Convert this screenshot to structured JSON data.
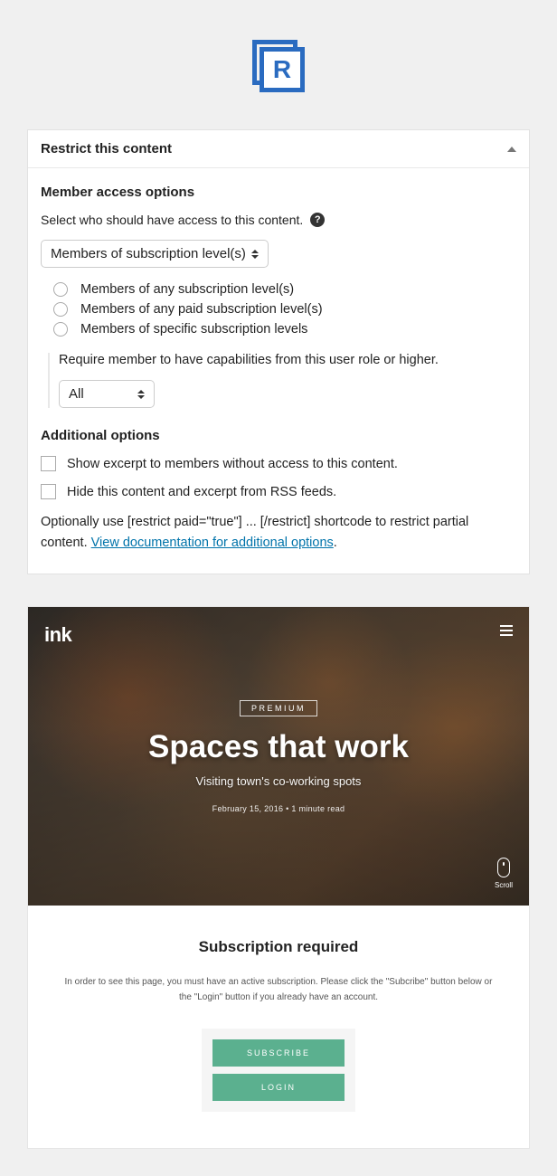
{
  "panel": {
    "title": "Restrict this content",
    "section1_title": "Member access options",
    "select_desc": "Select who should have access to this content.",
    "help_char": "?",
    "dropdown_value": "Members of subscription level(s)",
    "radios": [
      "Members of any subscription level(s)",
      "Members of any paid subscription level(s)",
      "Members of specific subscription levels"
    ],
    "require_text": "Require member to have capabilities from this user role or higher.",
    "role_dropdown_value": "All",
    "section2_title": "Additional options",
    "checkbox1": "Show excerpt to members without access to this content.",
    "checkbox2": "Hide this content and excerpt from RSS feeds.",
    "footer_pre": "Optionally use [restrict paid=\"true\"] ... [/restrict] shortcode to restrict partial content. ",
    "footer_link": "View documentation for additional options",
    "footer_post": "."
  },
  "preview": {
    "brand": "ink",
    "badge": "PREMIUM",
    "title": "Spaces that work",
    "subtitle": "Visiting town's co-working spots",
    "meta": "February 15, 2016 • 1 minute read",
    "scroll": "Scroll",
    "sub_title": "Subscription required",
    "sub_desc": "In order to see this page, you must have an active subscription. Please click the \"Subcribe\" button below or the \"Login\" button if you already have an account.",
    "btn_subscribe": "SUBSCRIBE",
    "btn_login": "LOGIN"
  }
}
